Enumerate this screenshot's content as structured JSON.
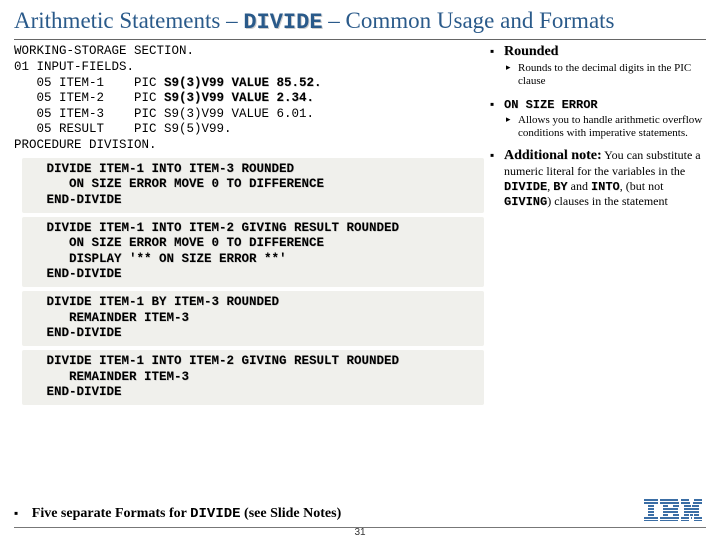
{
  "title": {
    "pre": "Arithmetic Statements – ",
    "keyword": "DIVIDE",
    "post": " – Common Usage and Formats"
  },
  "code": {
    "l1": "WORKING-STORAGE SECTION.",
    "l2": "01 INPUT-FIELDS.",
    "l3a": "   05 ITEM-1    PIC ",
    "l3b": "S9(3)V99 VALUE 85.52.",
    "l4a": "   05 ITEM-2    PIC ",
    "l4b": "S9(3)V99 VALUE 2.34.",
    "l5": "   05 ITEM-3    PIC S9(3)V99 VALUE 6.01.",
    "l6": "   05 RESULT    PIC S9(5)V99.",
    "l7": "PROCEDURE DIVISION.",
    "b1": "   DIVIDE ITEM-1 INTO ITEM-3 ROUNDED\n      ON SIZE ERROR MOVE 0 TO DIFFERENCE\n   END-DIVIDE",
    "b2": "   DIVIDE ITEM-1 INTO ITEM-2 GIVING RESULT ROUNDED\n      ON SIZE ERROR MOVE 0 TO DIFFERENCE\n      DISPLAY '** ON SIZE ERROR **'\n   END-DIVIDE",
    "b3": "   DIVIDE ITEM-1 BY ITEM-3 ROUNDED\n      REMAINDER ITEM-3\n   END-DIVIDE",
    "b4": "   DIVIDE ITEM-1 INTO ITEM-2 GIVING RESULT ROUNDED\n      REMAINDER ITEM-3\n   END-DIVIDE"
  },
  "right": {
    "rounded": "Rounded",
    "rounded_sub": "Rounds to the decimal digits in the PIC clause",
    "onsize": "ON SIZE ERROR",
    "onsize_sub": "Allows you to handle arithmetic overflow conditions with imperative statements.",
    "addl_head": "Additional note:",
    "addl_body1": " You can substitute a numeric literal for the variables in the ",
    "kw_divide": "DIVIDE",
    "addl_body2": ", ",
    "kw_by": "BY",
    "addl_body3": " and ",
    "kw_into": "INTO",
    "addl_body4": ", (but not ",
    "kw_giving": "GIVING",
    "addl_body5": ") clauses in the statement"
  },
  "footer": {
    "pre": "Five separate Formats for ",
    "kw": "DIVIDE",
    "post": " (see Slide Notes)"
  },
  "pagenum": "31"
}
